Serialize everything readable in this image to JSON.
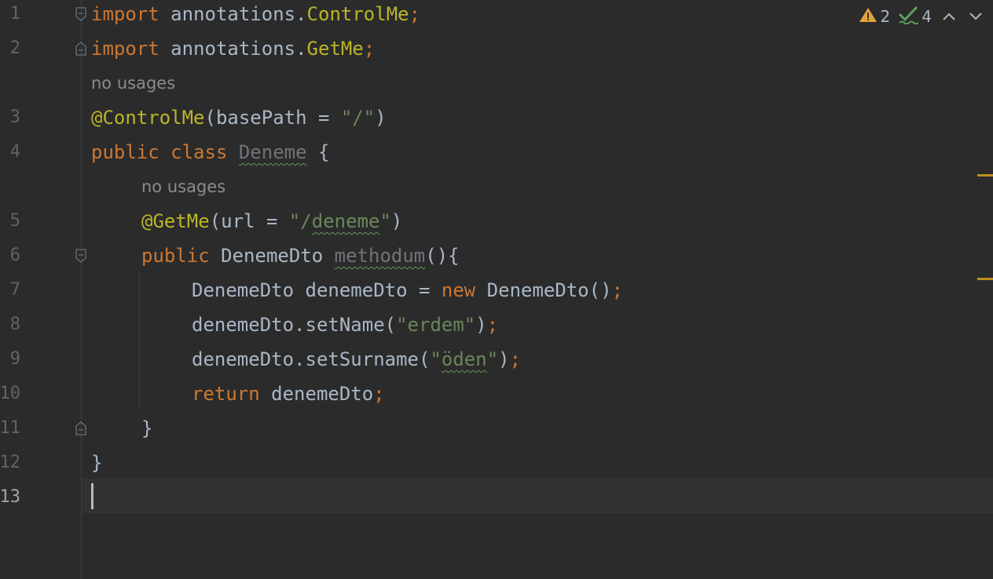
{
  "line_numbers": [
    "1",
    "2",
    "3",
    "4",
    "5",
    "6",
    "7",
    "8",
    "9",
    "10",
    "11",
    "12",
    "13"
  ],
  "hints": {
    "usage_class": "no usages",
    "usage_method": "no usages"
  },
  "code": {
    "l1": {
      "kw": "import",
      "sp": " annotations.",
      "cls": "ControlMe",
      "semi": ";"
    },
    "l2": {
      "kw": "import",
      "sp": " annotations.",
      "cls": "GetMe",
      "semi": ";"
    },
    "l3": {
      "ann": "@ControlMe",
      "rest": "(basePath = ",
      "str": "\"/\"",
      "close": ")"
    },
    "l4": {
      "kw1": "public",
      "kw2": "class",
      "name": "Deneme",
      "brace": "{"
    },
    "l5": {
      "ann": "@GetMe",
      "rest": "(url = ",
      "str_open": "\"/",
      "str_word": "deneme",
      "str_close": "\"",
      "close": ")"
    },
    "l6": {
      "kw": "public",
      "type": "DenemeDto",
      "name": "methodum",
      "rest": "(){"
    },
    "l7": {
      "a": "DenemeDto denemeDto = ",
      "kw": "new",
      "b": " DenemeDto()",
      "semi": ";"
    },
    "l8": {
      "a": "denemeDto.setName(",
      "str": "\"erdem\"",
      "b": ")",
      "semi": ";"
    },
    "l9": {
      "a": "denemeDto.setSurname(",
      "str_open": "\"",
      "str_word": "öden",
      "str_close": "\"",
      "b": ")",
      "semi": ";"
    },
    "l10": {
      "kw": "return",
      "a": " denemeDto",
      "semi": ";"
    },
    "l11": {
      "brace": "}"
    },
    "l12": {
      "brace": "}"
    }
  },
  "inspections": {
    "warnings": "2",
    "typos": "4"
  },
  "colors": {
    "warning": "#e2a33b",
    "typo": "#5fa05a",
    "stripe": "#be9117"
  }
}
